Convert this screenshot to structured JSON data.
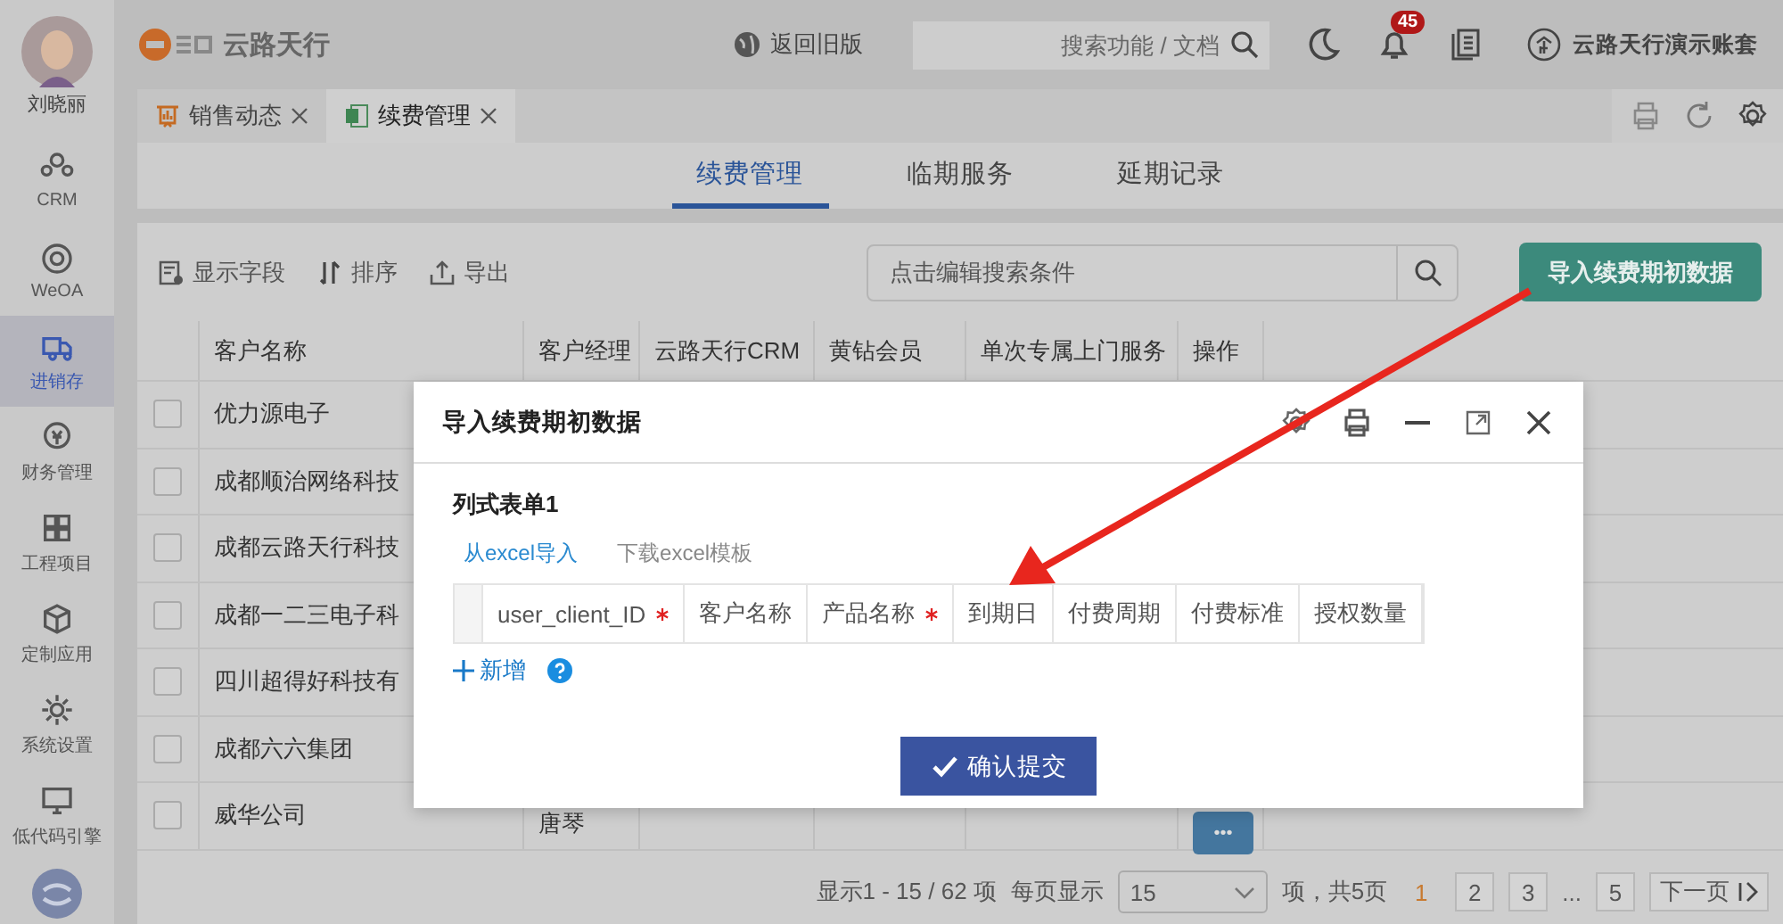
{
  "sidebar": {
    "user_name": "刘晓丽",
    "items": [
      {
        "label": "CRM",
        "selected": false
      },
      {
        "label": "WeOA",
        "selected": false
      },
      {
        "label": "进销存",
        "selected": true
      },
      {
        "label": "财务管理",
        "selected": false
      },
      {
        "label": "工程项目",
        "selected": false
      },
      {
        "label": "定制应用",
        "selected": false
      },
      {
        "label": "系统设置",
        "selected": false
      },
      {
        "label": "低代码引擎",
        "selected": false
      }
    ]
  },
  "header": {
    "logo_text": "云路天行",
    "back_link": "返回旧版",
    "search": {
      "placeholder": "搜索功能 / 文档"
    },
    "notification_count": "45",
    "account": "云路天行演示账套"
  },
  "tabs": [
    {
      "label": "销售动态",
      "selected": false
    },
    {
      "label": "续费管理",
      "selected": true
    }
  ],
  "subtabs": [
    {
      "label": "续费管理",
      "selected": true
    },
    {
      "label": "临期服务",
      "selected": false
    },
    {
      "label": "延期记录",
      "selected": false
    }
  ],
  "toolbar": {
    "buttons": [
      "显示字段",
      "排序",
      "导出"
    ],
    "search": {
      "placeholder": "点击编辑搜索条件"
    },
    "import_button": "导入续费期初数据"
  },
  "table": {
    "columns": [
      "客户名称",
      "客户经理",
      "云路天行CRM",
      "黄钻会员",
      "单次专属上门服务",
      "操作"
    ],
    "rows": [
      {
        "name": "优力源电子",
        "checked": false
      },
      {
        "name": "成都顺治网络科技",
        "checked": false
      },
      {
        "name": "成都云路天行科技",
        "checked": false
      },
      {
        "name": "成都一二三电子科",
        "checked": false
      },
      {
        "name": "四川超得好科技有",
        "checked": false
      },
      {
        "name": "成都六六集团",
        "checked": false
      },
      {
        "name": "威华公司",
        "checked": false,
        "manager": "唐琴",
        "action": "•••"
      }
    ]
  },
  "pagination": {
    "summary": "显示1 - 15 / 62 项",
    "per_page_label": "每页显示",
    "per_page": "15",
    "pages_label": "项，共5页",
    "pages": [
      {
        "label": "1",
        "selected": true
      },
      {
        "label": "2",
        "selected": false
      },
      {
        "label": "3",
        "selected": false
      },
      {
        "label": "...",
        "kind": "gap"
      },
      {
        "label": "5",
        "selected": false
      }
    ],
    "next": "下一页"
  },
  "dialog": {
    "title": "导入续费期初数据",
    "section_title": "列式表单1",
    "links": [
      {
        "label": "从excel导入",
        "selected": true
      },
      {
        "label": "下载excel模板",
        "selected": false
      }
    ],
    "columns": [
      {
        "label": "user_client_ID",
        "required": true
      },
      {
        "label": "客户名称",
        "required": false
      },
      {
        "label": "产品名称",
        "required": true
      },
      {
        "label": "到期日",
        "required": false
      },
      {
        "label": "付费周期",
        "required": false
      },
      {
        "label": "付费标准",
        "required": false
      },
      {
        "label": "授权数量",
        "required": false
      }
    ],
    "add_label": "新增",
    "submit": "确认提交"
  }
}
